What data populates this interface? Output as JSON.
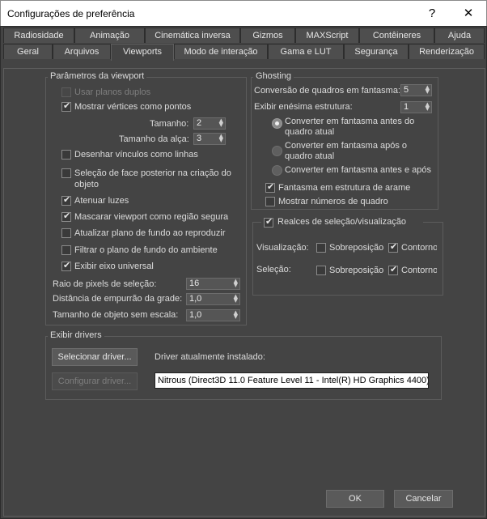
{
  "window": {
    "title": "Configurações de preferência",
    "help_glyph": "?",
    "close_glyph": "✕"
  },
  "tabs_row1": [
    "Radiosidade",
    "Animação",
    "Cinemática inversa",
    "Gizmos",
    "MAXScript",
    "Contêineres",
    "Ajuda"
  ],
  "tabs_row2": [
    "Geral",
    "Arquivos",
    "Viewports",
    "Modo de interação",
    "Gama e LUT",
    "Segurança",
    "Renderização"
  ],
  "active_tab": "Viewports",
  "viewport_params": {
    "title": "Parâmetros da viewport",
    "use_dual_planes": "Usar planos duplos",
    "show_vertices_as_dots": "Mostrar vértices como pontos",
    "size_label": "Tamanho:",
    "size_value": "2",
    "handle_size_label": "Tamanho da alça:",
    "handle_size_value": "3",
    "draw_links_as_lines": "Desenhar vínculos como linhas",
    "backface_cull": "Seleção de face posterior na criação do objeto",
    "attenuate_lights": "Atenuar luzes",
    "mask_viewport": "Mascarar viewport como região segura",
    "update_bg_on_play": "Atualizar plano de fundo ao reproduzir",
    "filter_env_bg": "Filtrar o plano de fundo do ambiente",
    "show_world_axis": "Exibir eixo universal",
    "pick_radius_label": "Raio de pixels de seleção:",
    "pick_radius_value": "16",
    "grid_nudge_label": "Distância de empurrão da grade:",
    "grid_nudge_value": "1,0",
    "non_scaling_label": "Tamanho de objeto sem escala:",
    "non_scaling_value": "1,0"
  },
  "ghosting": {
    "title": "Ghosting",
    "ghost_frames_label": "Conversão de quadros em fantasma:",
    "ghost_frames_value": "5",
    "nth_frame_label": "Exibir enésima estrutura:",
    "nth_frame_value": "1",
    "radio_before": "Converter em fantasma antes do quadro atual",
    "radio_after": "Converter em fantasma após o quadro atual",
    "radio_both": "Converter em fantasma antes e após",
    "wireframe_ghost": "Fantasma em estrutura de arame",
    "show_frame_numbers": "Mostrar números de quadro"
  },
  "highlights": {
    "title": "Realces de seleção/visualização",
    "preview_label": "Visualização:",
    "selection_label": "Seleção:",
    "overlay": "Sobreposição",
    "outline": "Contorno"
  },
  "drivers": {
    "title": "Exibir drivers",
    "select_driver": "Selecionar driver...",
    "configure_driver": "Configurar driver...",
    "installed_label": "Driver atualmente instalado:",
    "installed_value": "Nitrous (Direct3D 11.0 Feature Level 11 - Intel(R) HD Graphics 4400)"
  },
  "footer": {
    "ok": "OK",
    "cancel": "Cancelar"
  }
}
